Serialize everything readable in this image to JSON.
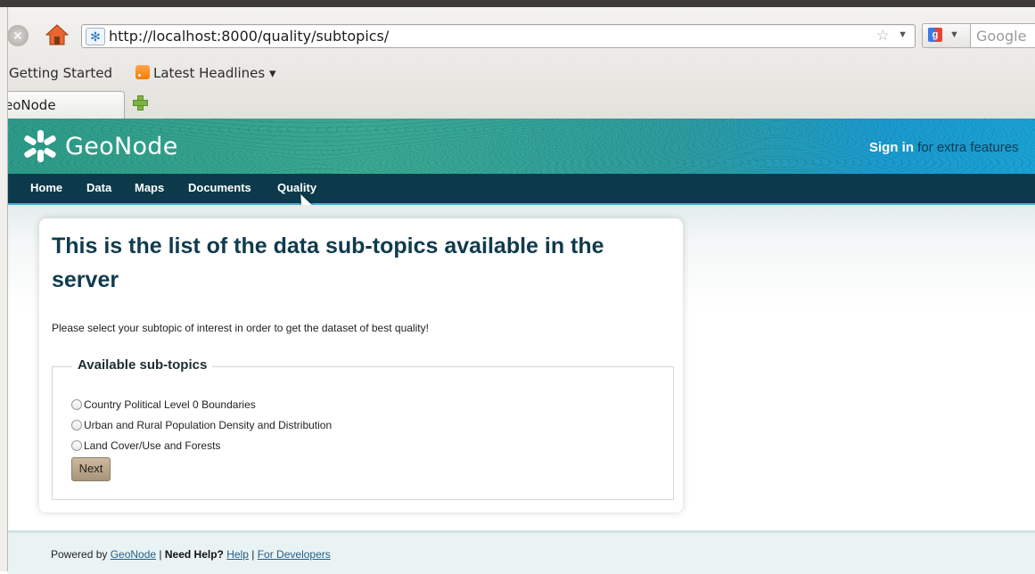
{
  "browser": {
    "url": "http://localhost:8000/quality/subtopics/",
    "search_placeholder": "Google",
    "bookmarks": [
      "Getting Started",
      "Latest Headlines ▾"
    ],
    "tab_label": "eoNode"
  },
  "site": {
    "logo_text": "GeoNode",
    "signin_link": "Sign in",
    "signin_suffix": " for extra features"
  },
  "nav": [
    "Home",
    "Data",
    "Maps",
    "Documents",
    "Quality"
  ],
  "main": {
    "heading": "This is the list of the data sub-topics available in the server",
    "intro": "Please select your subtopic of interest in order to get the dataset of best quality!",
    "legend": "Available sub-topics",
    "options": [
      "Country Political Level 0 Boundaries",
      "Urban and Rural Population Density and Distribution",
      "Land Cover/Use and Forests"
    ],
    "next_label": "Next"
  },
  "footer": {
    "powered_by": "Powered by ",
    "geonode_link": "GeoNode",
    "sep1": " | ",
    "need_help": "Need Help?",
    "help_link": "Help",
    "sep2": " | ",
    "dev_link": "For Developers"
  },
  "colors": {
    "nav_bg": "#0c3a4a",
    "heading": "#0f3b4d",
    "button": "#b8a489"
  }
}
